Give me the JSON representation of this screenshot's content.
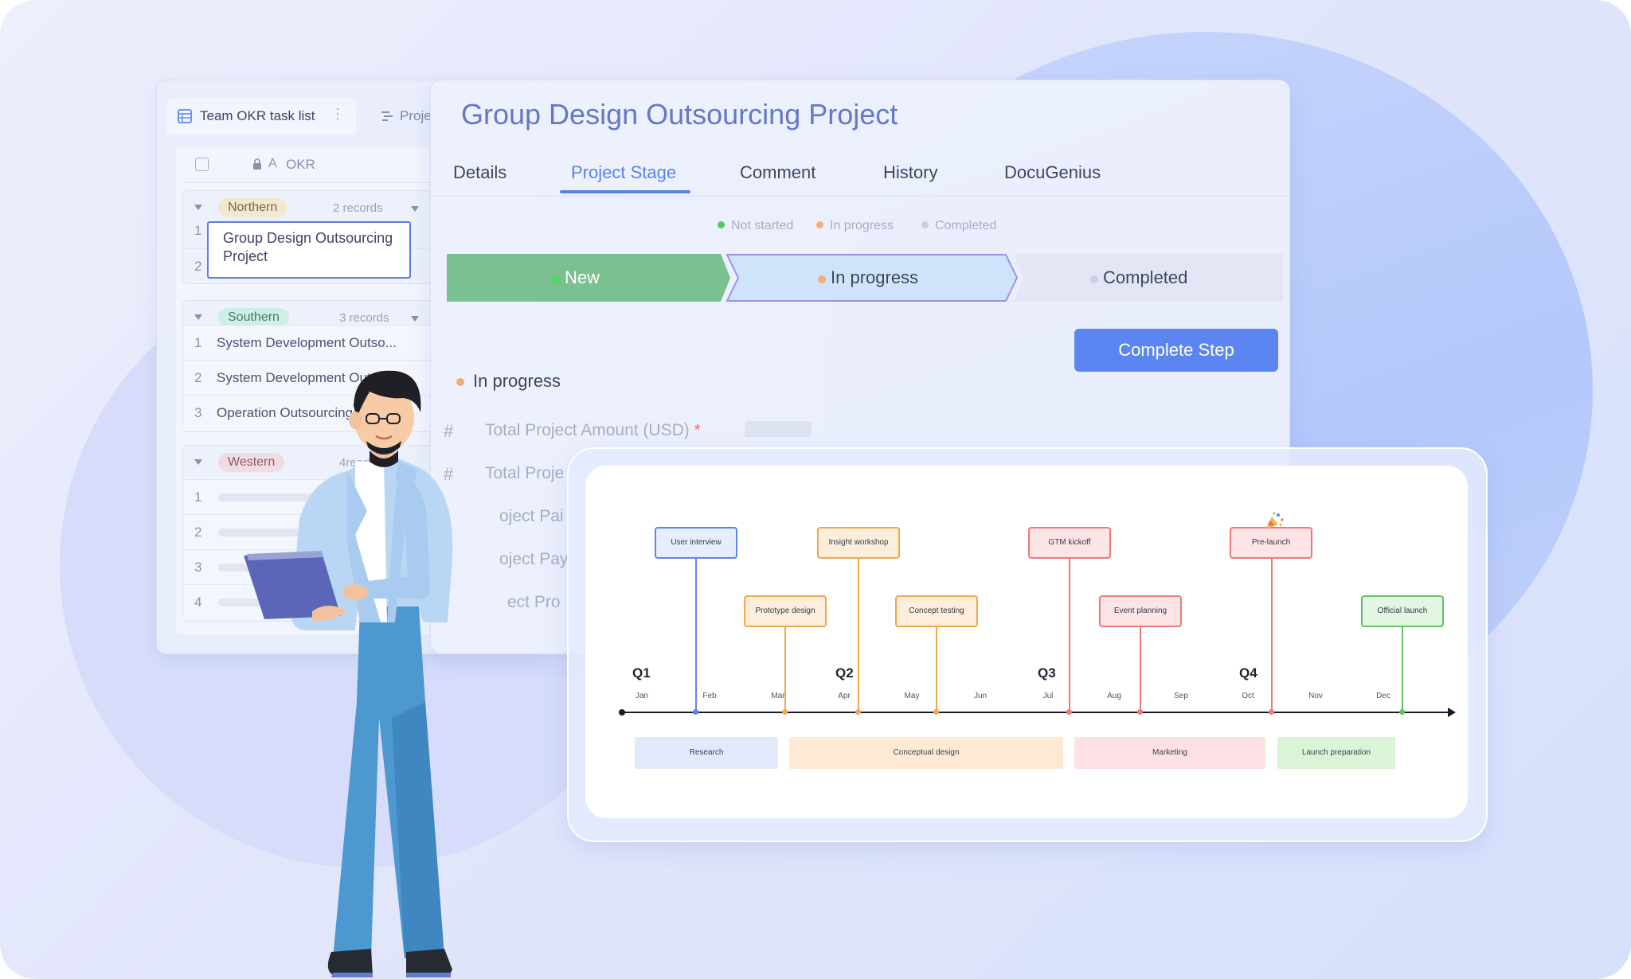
{
  "table": {
    "tab_label": "Team OKR task list",
    "tab2_label": "Proje",
    "column_header": "OKR",
    "groups": [
      {
        "name": "Northern",
        "count": "2 records",
        "rows": [
          {
            "num": "1",
            "text": ""
          },
          {
            "num": "2",
            "text": ""
          }
        ]
      },
      {
        "name": "Southern",
        "count": "3 records",
        "rows": [
          {
            "num": "1",
            "text": "System Development Outso..."
          },
          {
            "num": "2",
            "text": "System Development Outso"
          },
          {
            "num": "3",
            "text": "Operation Outsourcing Pro"
          }
        ]
      },
      {
        "name": "Western",
        "count": "4records",
        "rows": [
          {
            "num": "1"
          },
          {
            "num": "2"
          },
          {
            "num": "3"
          },
          {
            "num": "4"
          }
        ]
      }
    ],
    "selected_cell": [
      "Group Design Outsourcing",
      "Project"
    ],
    "tag_colors": {
      "Northern": "#f0e8cf",
      "Southern": "#cfeee6",
      "Western": "#f0dde3"
    }
  },
  "detail": {
    "title": "Group Design Outsourcing Project",
    "tabs": [
      "Details",
      "Project Stage",
      "Comment",
      "History",
      "DocuGenius"
    ],
    "active_tab": "Project Stage",
    "legend": [
      "Not started",
      "In progress",
      "Completed"
    ],
    "stages": [
      "New",
      "In progress",
      "Completed"
    ],
    "complete_button": "Complete Step",
    "section": "In progress",
    "fields": [
      "Total Project Amount (USD)",
      "Total Proje",
      "oject Pai",
      "oject Pay",
      "ect Pro"
    ],
    "required_mark": "*",
    "colors": {
      "new": "#7bc08f",
      "in_progress": "#cfe4fa",
      "completed": "#e2e6f5",
      "accent": "#5b86f2"
    }
  },
  "timeline": {
    "milestones": [
      {
        "label": "User interview",
        "color": "#5b86f2",
        "fill": "#e6eefe"
      },
      {
        "label": "Prototype design",
        "color": "#f2a64e",
        "fill": "#fdeedb"
      },
      {
        "label": "Insight workshop",
        "color": "#f2a64e",
        "fill": "#fdeedb"
      },
      {
        "label": "Concept testing",
        "color": "#f2a64e",
        "fill": "#fdeedb"
      },
      {
        "label": "GTM kickoff",
        "color": "#ef7878",
        "fill": "#fde4e6"
      },
      {
        "label": "Event planning",
        "color": "#ef7878",
        "fill": "#fde4e6"
      },
      {
        "label": "Pre-launch",
        "color": "#ef7878",
        "fill": "#fde4e6"
      },
      {
        "label": "Official launch",
        "color": "#5cc466",
        "fill": "#e3f6e2"
      }
    ],
    "quarters": [
      "Q1",
      "Q2",
      "Q3",
      "Q4"
    ],
    "months": [
      "Jan",
      "Feb",
      "Mar",
      "Apr",
      "May",
      "Jun",
      "Jul",
      "Aug",
      "Sep",
      "Oct",
      "Nov",
      "Dec"
    ],
    "phases": [
      {
        "label": "Research",
        "fill": "#e3eafb"
      },
      {
        "label": "Conceptual design",
        "fill": "#fde9d4"
      },
      {
        "label": "Marketing",
        "fill": "#fde1e4"
      },
      {
        "label": "Launch preparation",
        "fill": "#dbf3d7"
      }
    ],
    "decoration_icon": "party-popper-icon"
  }
}
